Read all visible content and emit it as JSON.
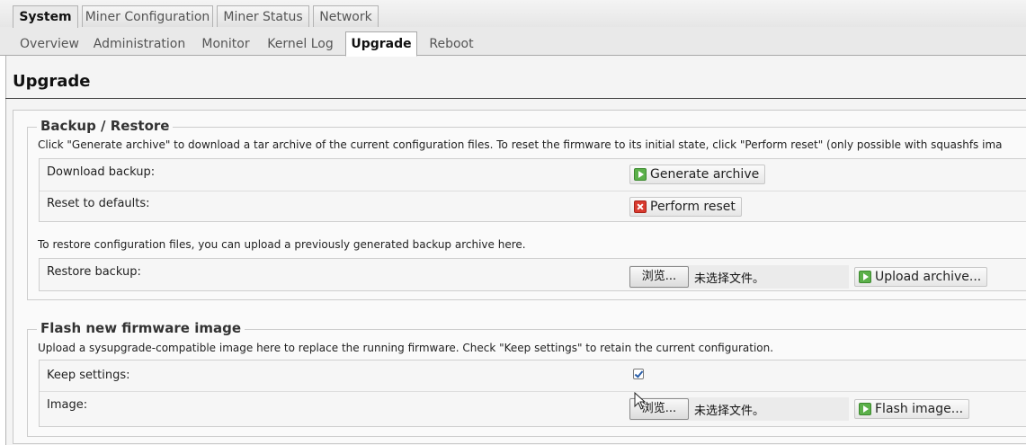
{
  "top_tabs": [
    {
      "label": "System",
      "active": true
    },
    {
      "label": "Miner Configuration",
      "active": false
    },
    {
      "label": "Miner Status",
      "active": false
    },
    {
      "label": "Network",
      "active": false
    }
  ],
  "sub_tabs": [
    {
      "label": "Overview",
      "active": false
    },
    {
      "label": "Administration",
      "active": false
    },
    {
      "label": "Monitor",
      "active": false
    },
    {
      "label": "Kernel Log",
      "active": false
    },
    {
      "label": "Upgrade",
      "active": true
    },
    {
      "label": "Reboot",
      "active": false
    }
  ],
  "page": {
    "title": "Upgrade"
  },
  "backup_restore": {
    "legend": "Backup / Restore",
    "description": "Click \"Generate archive\" to download a tar archive of the current configuration files. To reset the firmware to its initial state, click \"Perform reset\" (only possible with squashfs ima",
    "download_label": "Download backup:",
    "generate_button": "Generate archive",
    "reset_label": "Reset to defaults:",
    "reset_button": "Perform reset",
    "restore_description": "To restore configuration files, you can upload a previously generated backup archive here.",
    "restore_label": "Restore backup:",
    "browse_button": "浏览...",
    "file_status": "未选择文件。",
    "upload_button": "Upload archive..."
  },
  "flash": {
    "legend": "Flash new firmware image",
    "description": "Upload a sysupgrade-compatible image here to replace the running firmware. Check \"Keep settings\" to retain the current configuration.",
    "keep_label": "Keep settings:",
    "keep_checked": true,
    "image_label": "Image:",
    "browse_button": "浏览...",
    "file_status": "未选择文件。",
    "flash_button": "Flash image..."
  },
  "colors": {
    "go_icon": "#5bb04a",
    "reset_icon": "#d93a2f",
    "checkbox_check": "#2a5ea8"
  },
  "icons": {
    "generate": "play-icon",
    "reset": "reset-icon",
    "upload": "play-icon",
    "flash": "play-icon"
  }
}
